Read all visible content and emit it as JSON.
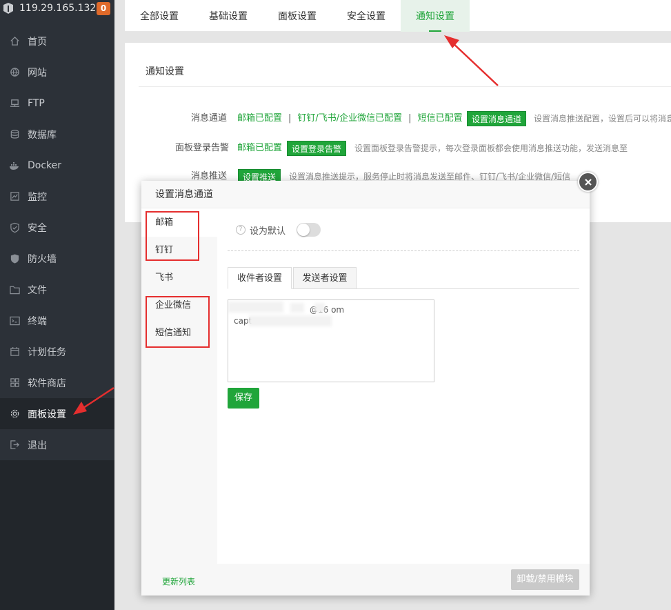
{
  "sidebar": {
    "ip": "119.29.165.132",
    "badge": "0",
    "items": [
      {
        "label": "首页",
        "icon": "home-icon"
      },
      {
        "label": "网站",
        "icon": "globe-icon"
      },
      {
        "label": "FTP",
        "icon": "ftp-icon"
      },
      {
        "label": "数据库",
        "icon": "database-icon"
      },
      {
        "label": "Docker",
        "icon": "docker-icon"
      },
      {
        "label": "监控",
        "icon": "monitor-icon"
      },
      {
        "label": "安全",
        "icon": "shield-icon"
      },
      {
        "label": "防火墙",
        "icon": "firewall-icon"
      },
      {
        "label": "文件",
        "icon": "folder-icon"
      },
      {
        "label": "终端",
        "icon": "terminal-icon"
      },
      {
        "label": "计划任务",
        "icon": "calendar-icon"
      },
      {
        "label": "软件商店",
        "icon": "apps-icon"
      },
      {
        "label": "面板设置",
        "icon": "gear-icon"
      },
      {
        "label": "退出",
        "icon": "logout-icon"
      }
    ],
    "active_index": 12
  },
  "top_tabs": [
    "全部设置",
    "基础设置",
    "面板设置",
    "安全设置",
    "通知设置"
  ],
  "top_tabs_active": 4,
  "panel": {
    "title": "通知设置",
    "row1": {
      "label": "消息通道",
      "email": "邮箱已配置",
      "dingtalk": "钉钉/飞书/企业微信已配置",
      "sms": "短信已配置",
      "button": "设置消息通道",
      "hint": "设置消息推送配置，设置后可以将消息"
    },
    "row2": {
      "label": "面板登录告警",
      "email": "邮箱已配置",
      "button": "设置登录告警",
      "hint": "设置面板登录告警提示，每次登录面板都会使用消息推送功能，发送消息至"
    },
    "row3": {
      "label": "消息推送",
      "button": "设置推送",
      "hint": "设置消息推送提示，服务停止时将消息发送至邮件、钉钉/飞书/企业微信/短信"
    }
  },
  "modal": {
    "title": "设置消息通道",
    "nav": [
      "邮箱",
      "钉钉",
      "飞书",
      "企业微信",
      "短信通知"
    ],
    "nav_active": 0,
    "update_list": "更新列表",
    "default_label": "设为默认",
    "default_on": false,
    "sub_tabs": [
      "收件者设置",
      "发送者设置"
    ],
    "sub_tab_active": 0,
    "textarea_lines": [
      "@16 om",
      "capt"
    ],
    "save": "保存",
    "uninstall": "卸载/禁用模块"
  },
  "colors": {
    "accent": "#20a53a",
    "sidebar": "#2c3138",
    "annotation": "#e52e2e"
  }
}
